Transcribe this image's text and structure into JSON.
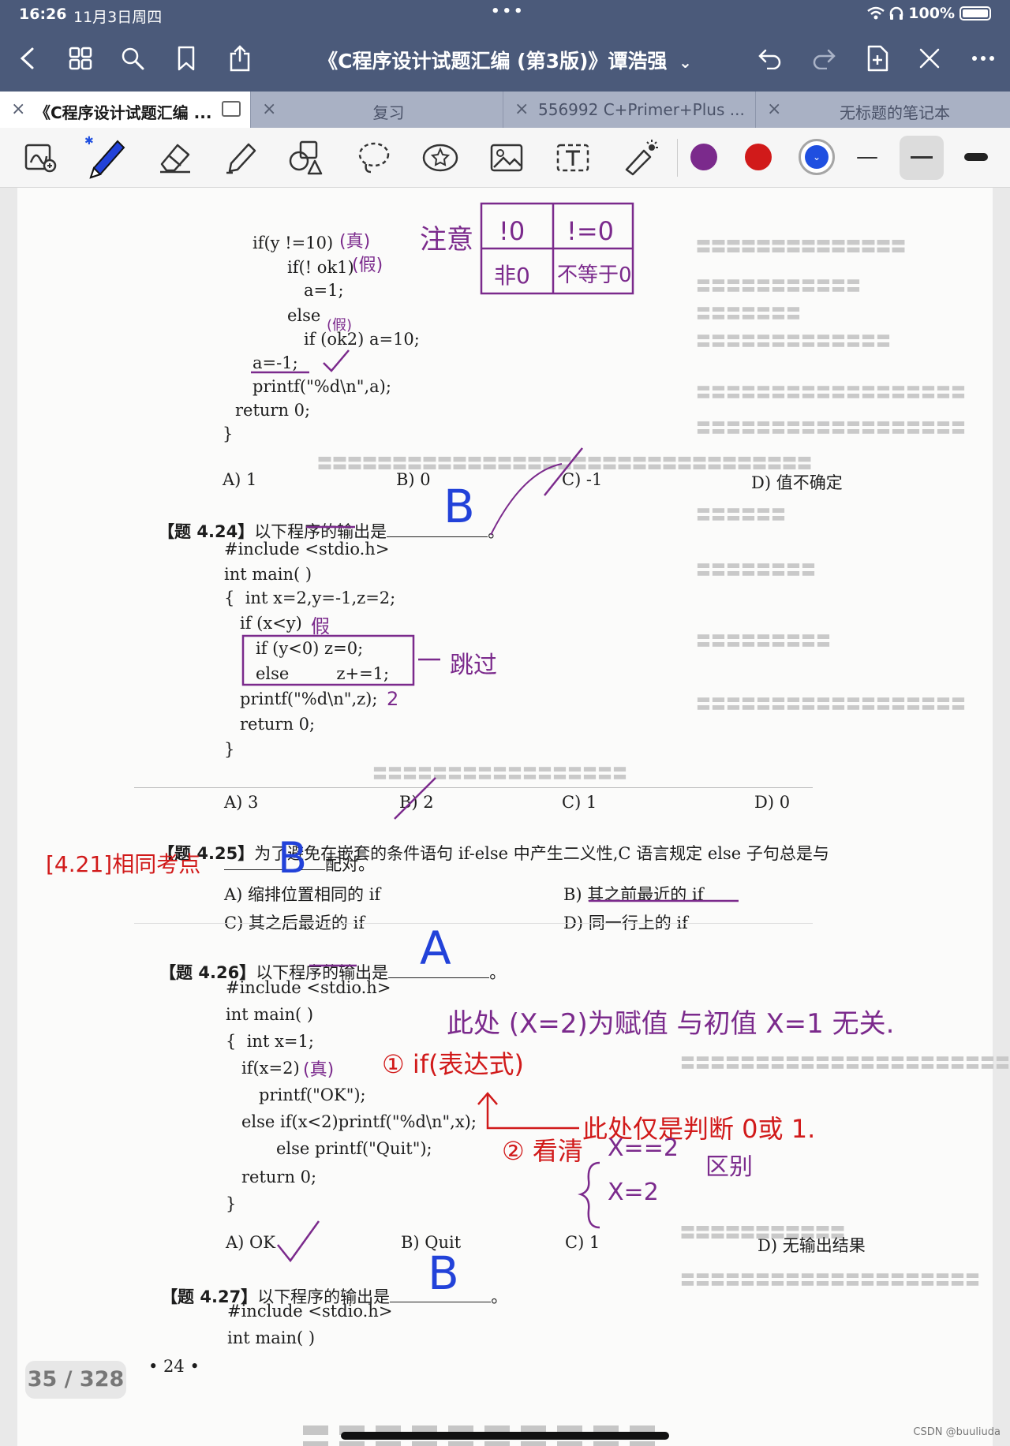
{
  "status": {
    "time": "16:26",
    "date": "11月3日周四",
    "dots": "•••",
    "battery": "100%"
  },
  "header": {
    "title": "《C程序设计试题汇编 (第3版)》谭浩强",
    "title_chevron": "⌄"
  },
  "tabs": [
    {
      "label": "《C程序设计试题汇编 ...",
      "close": "×"
    },
    {
      "label": "复习",
      "close": "×"
    },
    {
      "label": "556992 C+Primer+Plus ...",
      "close": "×"
    },
    {
      "label": "无标题的笔记本",
      "close": "×"
    }
  ],
  "colors": {
    "header_bg": "#4b5a7a",
    "swatch_purple": "#7b2a8c",
    "swatch_red": "#d11a1a",
    "swatch_blue": "#1f4fe0"
  },
  "doc": {
    "code1": [
      "if(y !=10)",
      "if(! ok1)",
      "a=1;",
      "else",
      "if (ok2) a=10;",
      "a=-1;",
      "printf(\"%d\\n\",a);",
      "return 0;",
      "}"
    ],
    "q423_options": [
      "A) 1",
      "B) 0",
      "C) -1",
      "D) 值不确定"
    ],
    "q424": {
      "num": "【题 4.24】",
      "text": "以下程序的输出是",
      "blank": "。"
    },
    "code2": [
      "#include <stdio.h>",
      "int main( )",
      "{  int x=2,y=-1,z=2;",
      "if (x<y)",
      "if (y<0) z=0;",
      "else         z+=1;",
      "printf(\"%d\\n\",z);",
      "return 0;",
      "}"
    ],
    "q424_options": [
      "A) 3",
      "B) 2",
      "C) 1",
      "D) 0"
    ],
    "q425": {
      "num": "【题 4.25】",
      "text": "为了避免在嵌套的条件语句 if-else 中产生二义性,C 语言规定 else 子句总是与",
      "line2": "配对。"
    },
    "q425_options": [
      "A) 缩排位置相同的 if",
      "B) 其之前最近的 if",
      "C) 其之后最近的 if",
      "D) 同一行上的 if"
    ],
    "q426": {
      "num": "【题 4.26】",
      "text": "以下程序的输出是",
      "blank": "。"
    },
    "code3": [
      "#include <stdio.h>",
      "int main( )",
      "{  int x=1;",
      "if(x=2)",
      "printf(\"OK\");",
      "else if(x<2)printf(\"%d\\n\",x);",
      "else printf(\"Quit\");",
      "return 0;",
      "}"
    ],
    "q426_options": [
      "A) OK",
      "B) Quit",
      "C) 1",
      "D) 无输出结果"
    ],
    "q427": {
      "num": "【题 4.27】",
      "text": "以下程序的输出是",
      "blank": "。"
    },
    "code4": [
      "#include <stdio.h>",
      "int main( )"
    ],
    "page_num": "• 24 •"
  },
  "notes": {
    "zhen": "(真)",
    "jia": "(假)",
    "jia2": "(假)",
    "zhuyi": "注意",
    "table": [
      "!0",
      "!=0",
      "非0",
      "不等于0"
    ],
    "ans424": "B",
    "ans425": "B",
    "ans426": "A",
    "ans427": "B",
    "jia3": "假",
    "tiaoguo": "跳过",
    "two": "2",
    "ref425": "[4.21]相同考点",
    "n1": "此处 (X=2)为赋值 与初值 X=1 无关.",
    "n2": "① if(表达式)",
    "n3": "此处仅是判断 0或 1.",
    "n4": "② 看清",
    "n5a": "X==2",
    "n5b": "X=2",
    "n5c": "区别",
    "zhen2": "(真)"
  },
  "pager": {
    "label": "35 / 328"
  },
  "watermark": {
    "credit": "CSDN @buuliuda"
  }
}
